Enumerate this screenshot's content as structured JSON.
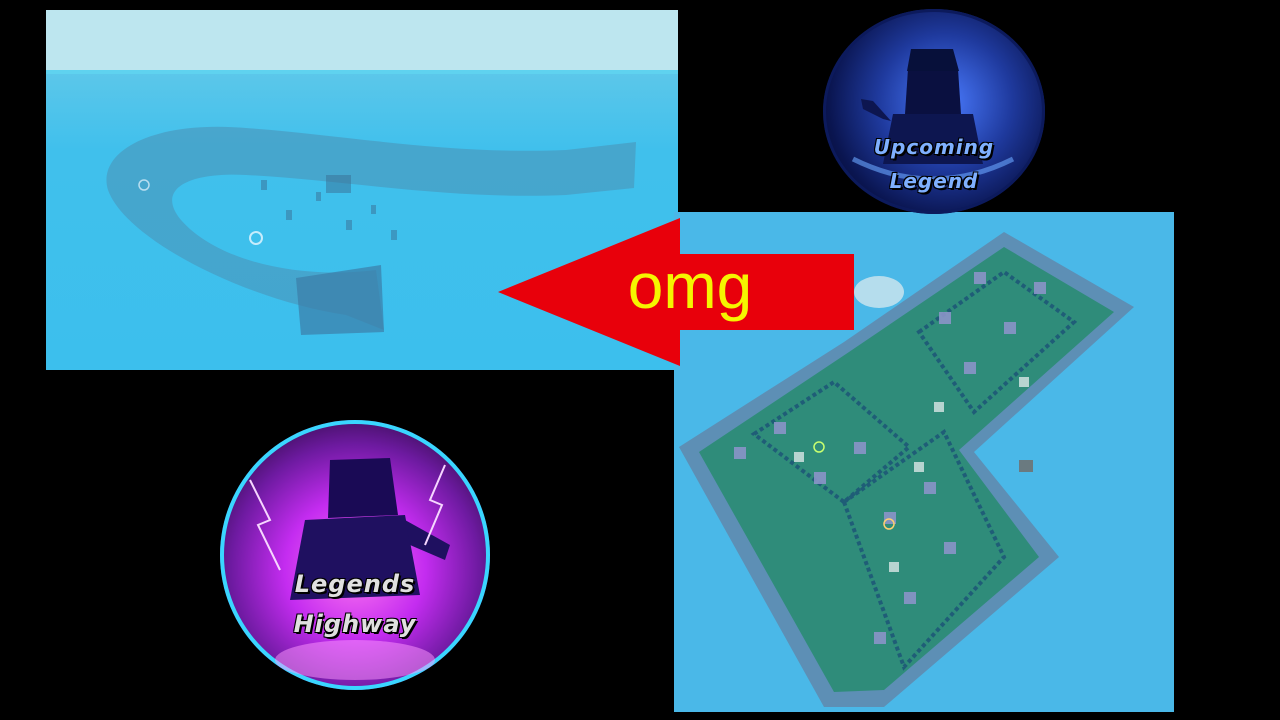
{
  "arrow": {
    "label": "omg",
    "color": "#e8000b",
    "label_color": "#f5f500"
  },
  "badges": {
    "upcoming": {
      "line1": "Upcoming",
      "line2": "Legend"
    },
    "legends_highway": {
      "line1": "Legends",
      "line2": "Highway"
    }
  },
  "screenshots": {
    "left": {
      "description_icon": "race-track-icon"
    },
    "right": {
      "description_icon": "obby-map-icon"
    }
  },
  "colors": {
    "background": "#000000",
    "water": "#3cbfed",
    "grass": "#2f8c7a",
    "wall": "#5d8fb5"
  }
}
